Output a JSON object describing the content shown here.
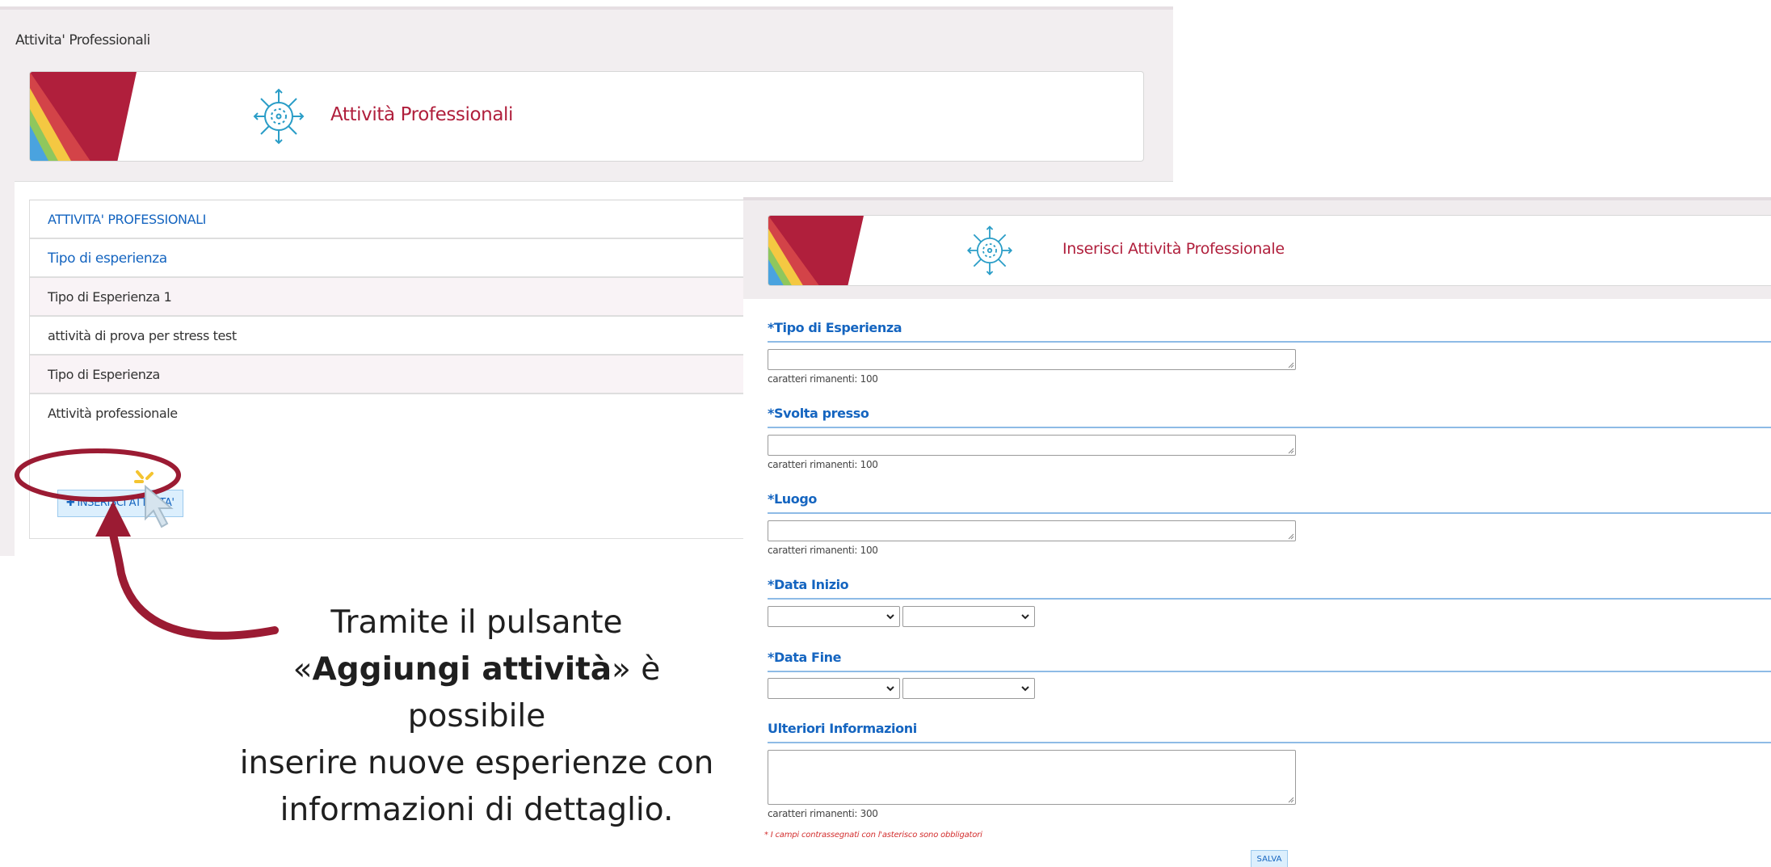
{
  "list_page": {
    "breadcrumb": "Attivita' Professionali",
    "banner_title": "Attività Professionali",
    "table": {
      "section_header": "ATTIVITA' PROFESSIONALI",
      "column_header": "Tipo di esperienza",
      "rows": [
        "Tipo di Esperienza 1",
        "attività di prova per stress test",
        "Tipo di Esperienza",
        "Attività professionale"
      ]
    },
    "insert_button": {
      "icon": "plus-icon",
      "label": "INSERISCI ATTIVITA'"
    }
  },
  "caption": {
    "line1": "Tramite il pulsante",
    "open_quote": "«",
    "bold": "Aggiungi attività",
    "close_quote": "» è possibile",
    "line3": "inserire nuove esperienze con",
    "line4": "informazioni di dettaglio."
  },
  "form_page": {
    "banner_title": "Inserisci Attività Professionale",
    "fields": {
      "tipo": {
        "label": "*Tipo di Esperienza",
        "value": "",
        "chars_left": "caratteri rimanenti: 100"
      },
      "svolta": {
        "label": "*Svolta presso",
        "value": "",
        "chars_left": "caratteri rimanenti: 100"
      },
      "luogo": {
        "label": "*Luogo",
        "value": "",
        "chars_left": "caratteri rimanenti: 100"
      },
      "data_inizio": {
        "label": "*Data Inizio",
        "month": "",
        "year": ""
      },
      "data_fine": {
        "label": "*Data Fine",
        "month": "",
        "year": ""
      },
      "ulteriori": {
        "label": "Ulteriori Informazioni",
        "value": "",
        "chars_left": "caratteri rimanenti: 300"
      }
    },
    "required_note": "* I campi contrassegnati con l'asterisco sono obbligatori",
    "save_label": "SALVA"
  },
  "colors": {
    "accent_blue": "#1565c0",
    "title_red": "#b01f3c",
    "annotation_red": "#9b1b33",
    "rule_blue": "#8ebbe6"
  }
}
